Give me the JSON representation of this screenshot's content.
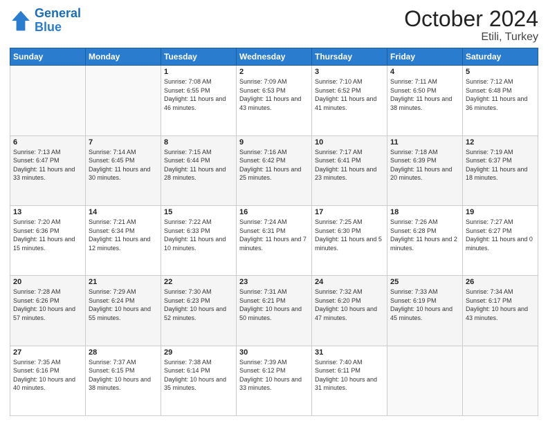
{
  "header": {
    "logo_line1": "General",
    "logo_line2": "Blue",
    "month": "October 2024",
    "location": "Etili, Turkey"
  },
  "days_of_week": [
    "Sunday",
    "Monday",
    "Tuesday",
    "Wednesday",
    "Thursday",
    "Friday",
    "Saturday"
  ],
  "weeks": [
    [
      {
        "day": "",
        "info": ""
      },
      {
        "day": "",
        "info": ""
      },
      {
        "day": "1",
        "info": "Sunrise: 7:08 AM\nSunset: 6:55 PM\nDaylight: 11 hours and 46 minutes."
      },
      {
        "day": "2",
        "info": "Sunrise: 7:09 AM\nSunset: 6:53 PM\nDaylight: 11 hours and 43 minutes."
      },
      {
        "day": "3",
        "info": "Sunrise: 7:10 AM\nSunset: 6:52 PM\nDaylight: 11 hours and 41 minutes."
      },
      {
        "day": "4",
        "info": "Sunrise: 7:11 AM\nSunset: 6:50 PM\nDaylight: 11 hours and 38 minutes."
      },
      {
        "day": "5",
        "info": "Sunrise: 7:12 AM\nSunset: 6:48 PM\nDaylight: 11 hours and 36 minutes."
      }
    ],
    [
      {
        "day": "6",
        "info": "Sunrise: 7:13 AM\nSunset: 6:47 PM\nDaylight: 11 hours and 33 minutes."
      },
      {
        "day": "7",
        "info": "Sunrise: 7:14 AM\nSunset: 6:45 PM\nDaylight: 11 hours and 30 minutes."
      },
      {
        "day": "8",
        "info": "Sunrise: 7:15 AM\nSunset: 6:44 PM\nDaylight: 11 hours and 28 minutes."
      },
      {
        "day": "9",
        "info": "Sunrise: 7:16 AM\nSunset: 6:42 PM\nDaylight: 11 hours and 25 minutes."
      },
      {
        "day": "10",
        "info": "Sunrise: 7:17 AM\nSunset: 6:41 PM\nDaylight: 11 hours and 23 minutes."
      },
      {
        "day": "11",
        "info": "Sunrise: 7:18 AM\nSunset: 6:39 PM\nDaylight: 11 hours and 20 minutes."
      },
      {
        "day": "12",
        "info": "Sunrise: 7:19 AM\nSunset: 6:37 PM\nDaylight: 11 hours and 18 minutes."
      }
    ],
    [
      {
        "day": "13",
        "info": "Sunrise: 7:20 AM\nSunset: 6:36 PM\nDaylight: 11 hours and 15 minutes."
      },
      {
        "day": "14",
        "info": "Sunrise: 7:21 AM\nSunset: 6:34 PM\nDaylight: 11 hours and 12 minutes."
      },
      {
        "day": "15",
        "info": "Sunrise: 7:22 AM\nSunset: 6:33 PM\nDaylight: 11 hours and 10 minutes."
      },
      {
        "day": "16",
        "info": "Sunrise: 7:24 AM\nSunset: 6:31 PM\nDaylight: 11 hours and 7 minutes."
      },
      {
        "day": "17",
        "info": "Sunrise: 7:25 AM\nSunset: 6:30 PM\nDaylight: 11 hours and 5 minutes."
      },
      {
        "day": "18",
        "info": "Sunrise: 7:26 AM\nSunset: 6:28 PM\nDaylight: 11 hours and 2 minutes."
      },
      {
        "day": "19",
        "info": "Sunrise: 7:27 AM\nSunset: 6:27 PM\nDaylight: 11 hours and 0 minutes."
      }
    ],
    [
      {
        "day": "20",
        "info": "Sunrise: 7:28 AM\nSunset: 6:26 PM\nDaylight: 10 hours and 57 minutes."
      },
      {
        "day": "21",
        "info": "Sunrise: 7:29 AM\nSunset: 6:24 PM\nDaylight: 10 hours and 55 minutes."
      },
      {
        "day": "22",
        "info": "Sunrise: 7:30 AM\nSunset: 6:23 PM\nDaylight: 10 hours and 52 minutes."
      },
      {
        "day": "23",
        "info": "Sunrise: 7:31 AM\nSunset: 6:21 PM\nDaylight: 10 hours and 50 minutes."
      },
      {
        "day": "24",
        "info": "Sunrise: 7:32 AM\nSunset: 6:20 PM\nDaylight: 10 hours and 47 minutes."
      },
      {
        "day": "25",
        "info": "Sunrise: 7:33 AM\nSunset: 6:19 PM\nDaylight: 10 hours and 45 minutes."
      },
      {
        "day": "26",
        "info": "Sunrise: 7:34 AM\nSunset: 6:17 PM\nDaylight: 10 hours and 43 minutes."
      }
    ],
    [
      {
        "day": "27",
        "info": "Sunrise: 7:35 AM\nSunset: 6:16 PM\nDaylight: 10 hours and 40 minutes."
      },
      {
        "day": "28",
        "info": "Sunrise: 7:37 AM\nSunset: 6:15 PM\nDaylight: 10 hours and 38 minutes."
      },
      {
        "day": "29",
        "info": "Sunrise: 7:38 AM\nSunset: 6:14 PM\nDaylight: 10 hours and 35 minutes."
      },
      {
        "day": "30",
        "info": "Sunrise: 7:39 AM\nSunset: 6:12 PM\nDaylight: 10 hours and 33 minutes."
      },
      {
        "day": "31",
        "info": "Sunrise: 7:40 AM\nSunset: 6:11 PM\nDaylight: 10 hours and 31 minutes."
      },
      {
        "day": "",
        "info": ""
      },
      {
        "day": "",
        "info": ""
      }
    ]
  ]
}
